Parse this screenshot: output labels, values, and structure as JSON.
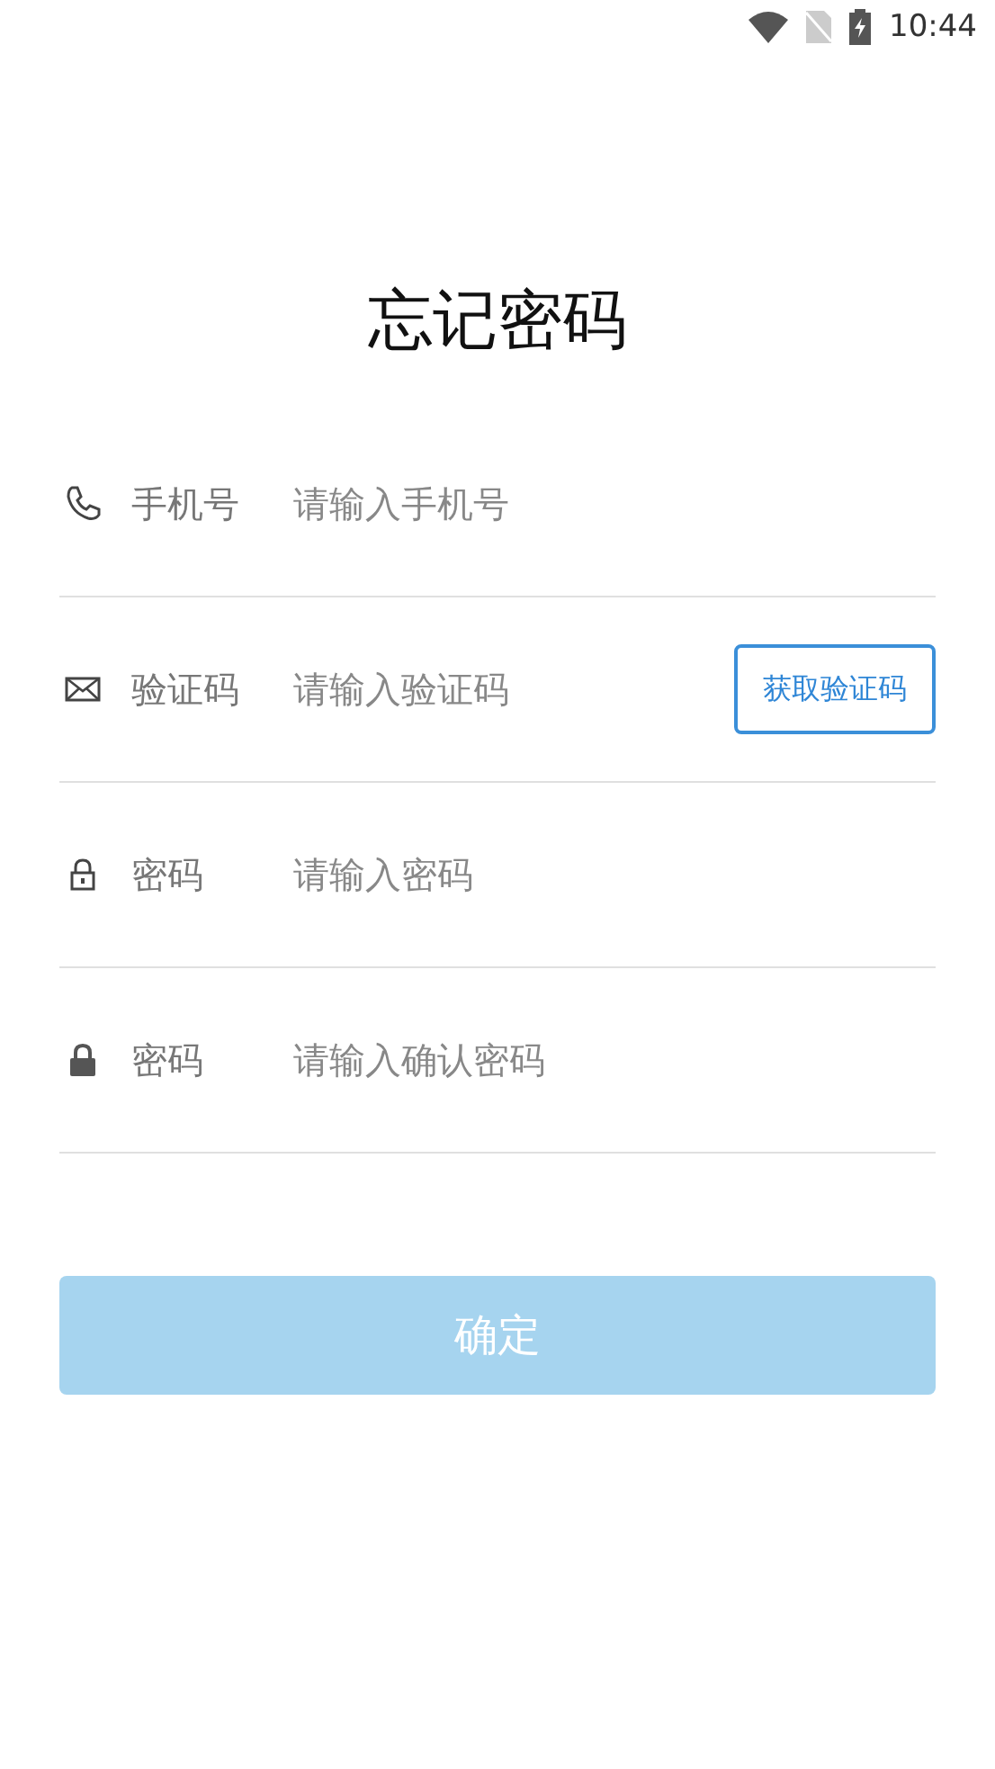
{
  "status_bar": {
    "time": "10:44"
  },
  "title": "忘记密码",
  "fields": [
    {
      "kind": "phone",
      "label": "手机号",
      "placeholder": "请输入手机号"
    },
    {
      "kind": "mail",
      "label": "验证码",
      "placeholder": "请输入验证码",
      "action": "获取验证码"
    },
    {
      "kind": "lock",
      "label": "密码",
      "placeholder": "请输入密码"
    },
    {
      "kind": "lock-solid",
      "label": "密码",
      "placeholder": "请输入确认密码"
    }
  ],
  "submit": {
    "label": "确定",
    "disabled": true
  }
}
